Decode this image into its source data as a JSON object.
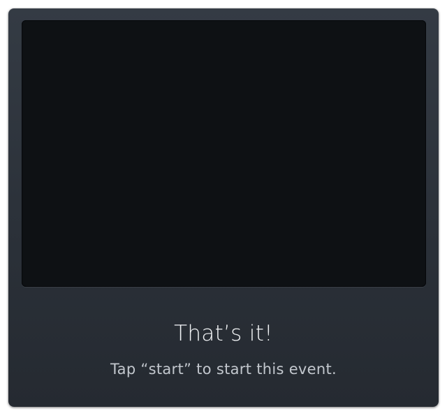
{
  "card": {
    "title": "That’s it!",
    "subtitle": "Tap “start” to start this event."
  },
  "colors": {
    "card_background": "#2b3139",
    "video_area": "#0e1114",
    "title_text": "#f2f4f6",
    "subtitle_text": "#c2c7cd"
  }
}
